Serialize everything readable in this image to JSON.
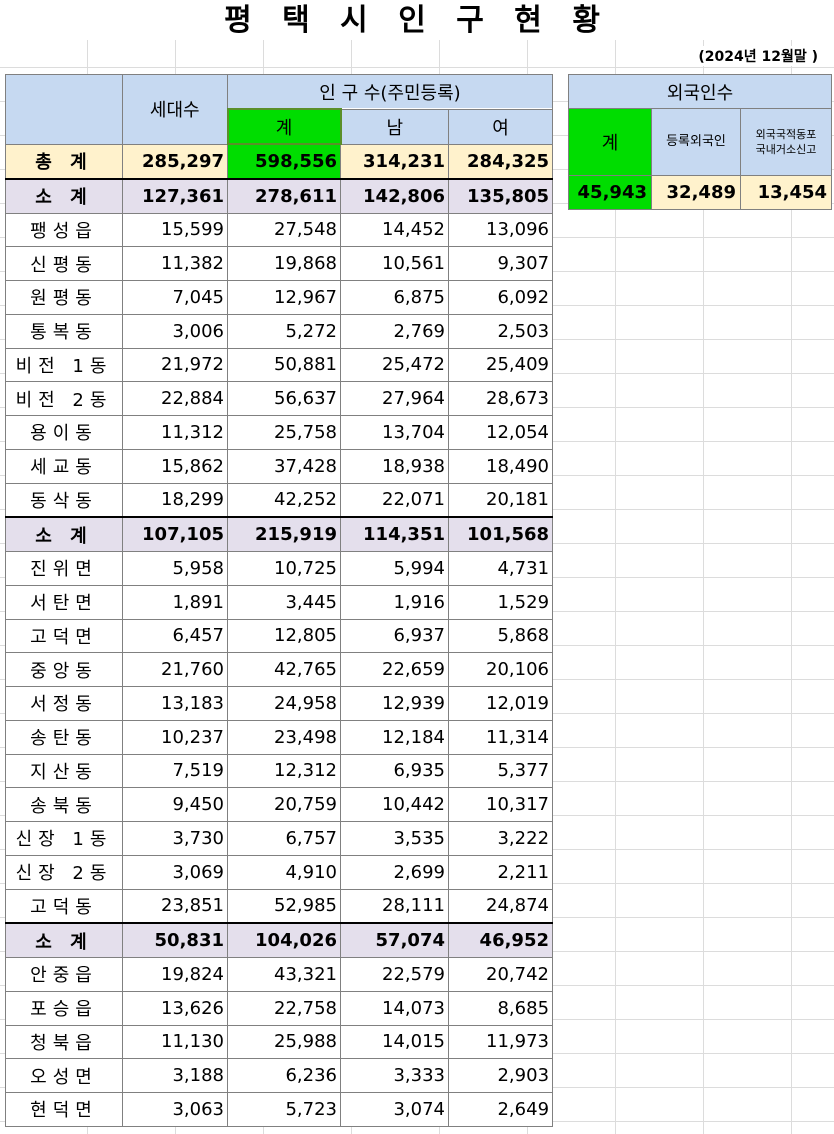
{
  "title": "평 택 시 인 구 현 황",
  "date_note": "(2024년 12월말 )",
  "headers": {
    "households": "세대수",
    "population": "인   구   수(주민등록)",
    "total": "계",
    "male": "남",
    "female": "여"
  },
  "grand_total": {
    "label": "총   계",
    "households": "285,297",
    "total": "598,556",
    "male": "314,231",
    "female": "284,325"
  },
  "groups": [
    {
      "subtotal": {
        "label": "소   계",
        "households": "127,361",
        "total": "278,611",
        "male": "142,806",
        "female": "135,805"
      },
      "rows": [
        {
          "name": "팽성읍",
          "households": "15,599",
          "total": "27,548",
          "male": "14,452",
          "female": "13,096"
        },
        {
          "name": "신평동",
          "households": "11,382",
          "total": "19,868",
          "male": "10,561",
          "female": "9,307"
        },
        {
          "name": "원평동",
          "households": "7,045",
          "total": "12,967",
          "male": "6,875",
          "female": "6,092"
        },
        {
          "name": "통복동",
          "households": "3,006",
          "total": "5,272",
          "male": "2,769",
          "female": "2,503"
        },
        {
          "name": "비전 1동",
          "households": "21,972",
          "total": "50,881",
          "male": "25,472",
          "female": "25,409"
        },
        {
          "name": "비전 2동",
          "households": "22,884",
          "total": "56,637",
          "male": "27,964",
          "female": "28,673"
        },
        {
          "name": "용이동",
          "households": "11,312",
          "total": "25,758",
          "male": "13,704",
          "female": "12,054"
        },
        {
          "name": "세교동",
          "households": "15,862",
          "total": "37,428",
          "male": "18,938",
          "female": "18,490"
        },
        {
          "name": "동삭동",
          "households": "18,299",
          "total": "42,252",
          "male": "22,071",
          "female": "20,181"
        }
      ]
    },
    {
      "subtotal": {
        "label": "소   계",
        "households": "107,105",
        "total": "215,919",
        "male": "114,351",
        "female": "101,568"
      },
      "rows": [
        {
          "name": "진위면",
          "households": "5,958",
          "total": "10,725",
          "male": "5,994",
          "female": "4,731"
        },
        {
          "name": "서탄면",
          "households": "1,891",
          "total": "3,445",
          "male": "1,916",
          "female": "1,529"
        },
        {
          "name": "고덕면",
          "households": "6,457",
          "total": "12,805",
          "male": "6,937",
          "female": "5,868"
        },
        {
          "name": "중앙동",
          "households": "21,760",
          "total": "42,765",
          "male": "22,659",
          "female": "20,106"
        },
        {
          "name": "서정동",
          "households": "13,183",
          "total": "24,958",
          "male": "12,939",
          "female": "12,019"
        },
        {
          "name": "송탄동",
          "households": "10,237",
          "total": "23,498",
          "male": "12,184",
          "female": "11,314"
        },
        {
          "name": "지산동",
          "households": "7,519",
          "total": "12,312",
          "male": "6,935",
          "female": "5,377"
        },
        {
          "name": "송북동",
          "households": "9,450",
          "total": "20,759",
          "male": "10,442",
          "female": "10,317"
        },
        {
          "name": "신장 1동",
          "households": "3,730",
          "total": "6,757",
          "male": "3,535",
          "female": "3,222"
        },
        {
          "name": "신장 2동",
          "households": "3,069",
          "total": "4,910",
          "male": "2,699",
          "female": "2,211"
        },
        {
          "name": "고덕동",
          "households": "23,851",
          "total": "52,985",
          "male": "28,111",
          "female": "24,874"
        }
      ]
    },
    {
      "subtotal": {
        "label": "소   계",
        "households": "50,831",
        "total": "104,026",
        "male": "57,074",
        "female": "46,952"
      },
      "rows": [
        {
          "name": "안중읍",
          "households": "19,824",
          "total": "43,321",
          "male": "22,579",
          "female": "20,742"
        },
        {
          "name": "포승읍",
          "households": "13,626",
          "total": "22,758",
          "male": "14,073",
          "female": "8,685"
        },
        {
          "name": "청북읍",
          "households": "11,130",
          "total": "25,988",
          "male": "14,015",
          "female": "11,973"
        },
        {
          "name": "오성면",
          "households": "3,188",
          "total": "6,236",
          "male": "3,333",
          "female": "2,903"
        },
        {
          "name": "현덕면",
          "households": "3,063",
          "total": "5,723",
          "male": "3,074",
          "female": "2,649"
        }
      ]
    }
  ],
  "foreign": {
    "header": "외국인수",
    "col_total": "계",
    "col_registered": "등록외국인",
    "col_compatriot_line1": "외국국적동포",
    "col_compatriot_line2": "국내거소신고",
    "total": "45,943",
    "registered": "32,489",
    "compatriot": "13,454"
  },
  "colors": {
    "header_blue": "#c6d9f1",
    "highlight_green": "#00dd00",
    "total_row": "#fff2cc",
    "subtotal_row": "#e4dfec"
  }
}
